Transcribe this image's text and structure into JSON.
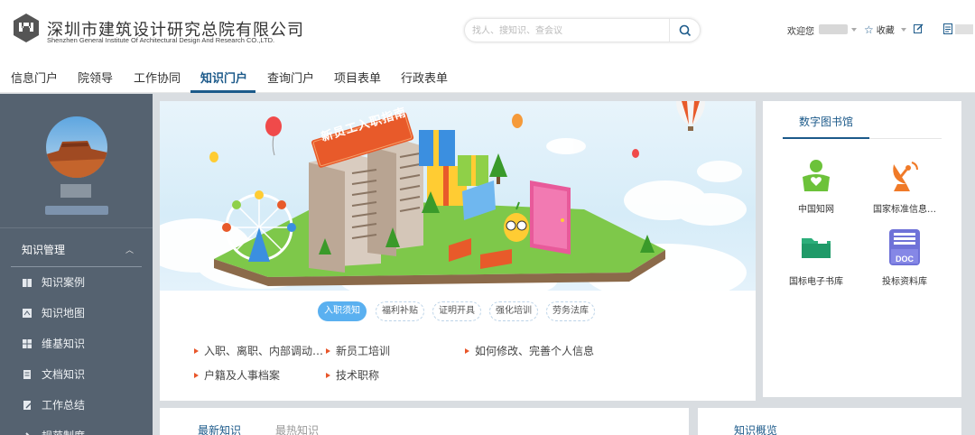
{
  "header": {
    "brand_cn": "深圳市建筑设计研究总院有限公司",
    "brand_en": "Shenzhen General Institute Of Architectural Design And Research CO.,LTD.",
    "search_placeholder": "找人、搜知识、查会议",
    "welcome": "欢迎您",
    "favorites": "收藏"
  },
  "nav": {
    "items": [
      "信息门户",
      "院领导",
      "工作协同",
      "知识门户",
      "查询门户",
      "项目表单",
      "行政表单"
    ],
    "active": "知识门户"
  },
  "sidebar": {
    "section_title": "知识管理",
    "items": [
      "知识案例",
      "知识地图",
      "维基知识",
      "文档知识",
      "工作总结",
      "规范制度"
    ]
  },
  "banner": {
    "sign_text": "新员工入职指南"
  },
  "guide_tabs": [
    "入职须知",
    "福利补贴",
    "证明开具",
    "强化培训",
    "劳务法库"
  ],
  "guide_links": [
    "入职、离职、内部调动…",
    "新员工培训",
    "如何修改、完善个人信息",
    "户籍及人事档案",
    "技术职称"
  ],
  "library": {
    "title": "数字图书馆",
    "items": [
      "中国知网",
      "国家标准信息…",
      "国标电子书库",
      "投标资料库"
    ],
    "doc_label": "DOC"
  },
  "bottom": {
    "tab_latest": "最新知识",
    "tab_hot": "最热知识",
    "overview": "知识概览"
  },
  "colors": {
    "accent": "#1c5a8a",
    "sidebar_bg": "#556270",
    "tab_active": "#5ab0f0",
    "arrow": "#e8562a"
  }
}
